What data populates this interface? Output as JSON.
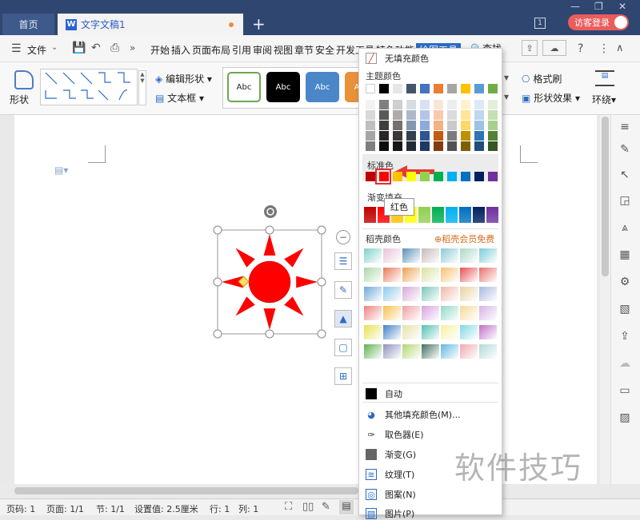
{
  "titlebar": {
    "home_tab": "首页",
    "doc_tab": "文字文稿1",
    "new_tab": "+",
    "badge": "1",
    "login": "访客登录",
    "minimize": "—",
    "restore": "❐",
    "close": "✕"
  },
  "menubar": {
    "file": "文件",
    "items": [
      "开始",
      "插入",
      "页面布局",
      "引用",
      "审阅",
      "视图",
      "章节",
      "安全",
      "开发工具",
      "特色功能",
      "绘图工具"
    ],
    "search": "查找",
    "help": "?",
    "more": "⋮",
    "collapse": "∧"
  },
  "ribbon": {
    "shape": "形状",
    "edit_shape": "编辑形状",
    "text_box": "文本框",
    "styles": [
      {
        "label": "Abc",
        "bg": "#ffffff",
        "fg": "#222222",
        "border": "#6aa84f"
      },
      {
        "label": "Abc",
        "bg": "#000000",
        "fg": "#ffffff",
        "border": "#000000"
      },
      {
        "label": "Abc",
        "bg": "#4a86c8",
        "fg": "#ffffff",
        "border": "#4a86c8"
      },
      {
        "label": "Abc",
        "bg": "#e8903a",
        "fg": "#ffffff",
        "border": "#e8903a"
      }
    ],
    "format_painter": "格式刷",
    "shape_effect": "形状效果",
    "wrap": "环绕"
  },
  "dropdown": {
    "no_fill": "无填充颜色",
    "theme_colors": "主题颜色",
    "theme_top": [
      "#ffffff",
      "#000000",
      "#e7e6e6",
      "#44546a",
      "#4472c4",
      "#ed7d31",
      "#a5a5a5",
      "#ffc000",
      "#5b9bd5",
      "#70ad47"
    ],
    "theme_shades": [
      [
        "#f2f2f2",
        "#7f7f7f",
        "#d0cece",
        "#d6dce4",
        "#d9e2f3",
        "#fbe5d5",
        "#ededed",
        "#fff2cc",
        "#deeaf6",
        "#e2efd9"
      ],
      [
        "#d8d8d8",
        "#595959",
        "#aeabab",
        "#adb9ca",
        "#b4c6e7",
        "#f7cbac",
        "#dbdbdb",
        "#fee599",
        "#bdd7ee",
        "#c5e0b3"
      ],
      [
        "#bfbfbf",
        "#3f3f3f",
        "#757070",
        "#8496b0",
        "#8eaadb",
        "#f4b183",
        "#c9c9c9",
        "#ffd965",
        "#9cc3e5",
        "#a8d08d"
      ],
      [
        "#a5a5a5",
        "#262626",
        "#3a3838",
        "#323f4f",
        "#2f5496",
        "#c55a11",
        "#7b7b7b",
        "#bf9000",
        "#2e75b5",
        "#538135"
      ],
      [
        "#7f7f7f",
        "#0c0c0c",
        "#171616",
        "#222a35",
        "#1f3864",
        "#833c0b",
        "#525252",
        "#7f6000",
        "#1e4e79",
        "#375623"
      ]
    ],
    "standard_colors_label": "标准色",
    "standard_colors": [
      "#c00000",
      "#ff0000",
      "#ffc000",
      "#ffff00",
      "#92d050",
      "#00b050",
      "#00b0f0",
      "#0070c0",
      "#002060",
      "#7030a0"
    ],
    "gradient_fill_label": "渐变填充",
    "gradient_colors": [
      "#c00000",
      "#ff0000",
      "#ffc000",
      "#ffff00",
      "#92d050",
      "#00b050",
      "#00b0f0",
      "#0070c0",
      "#002060",
      "#7030a0"
    ],
    "wps_colors_label": "稻壳颜色",
    "member_free": "稻壳会员免费",
    "auto": "自动",
    "other_fill": "其他填充颜色(M)...",
    "eyedropper": "取色器(E)",
    "gradient": "渐变(G)",
    "texture": "纹理(T)",
    "pattern": "图案(N)",
    "picture": "图片(P)"
  },
  "tooltip": "红色",
  "status": {
    "page_no": "页码: 1",
    "pages": "页面: 1/1",
    "section": "节: 1/1",
    "setting": "设置值: 2.5厘米",
    "row": "行: 1",
    "col": "列: 1"
  },
  "watermark": "软件技巧",
  "accent": "#2f4670",
  "sun_color": "#ff0000"
}
